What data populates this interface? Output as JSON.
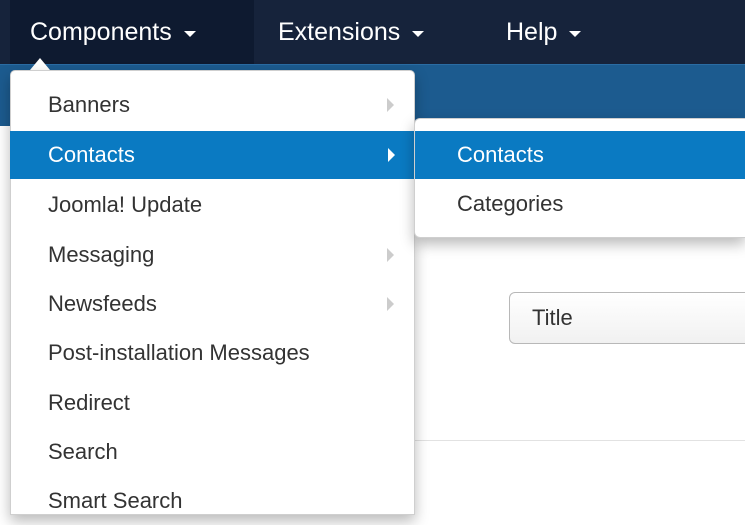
{
  "navbar": {
    "items": [
      {
        "label": "Components",
        "active": true
      },
      {
        "label": "Extensions",
        "active": false
      },
      {
        "label": "Help",
        "active": false
      }
    ]
  },
  "components_menu": {
    "items": [
      {
        "label": "Banners",
        "has_submenu": true,
        "highlighted": false
      },
      {
        "label": "Contacts",
        "has_submenu": true,
        "highlighted": true
      },
      {
        "label": "Joomla! Update",
        "has_submenu": false,
        "highlighted": false
      },
      {
        "label": "Messaging",
        "has_submenu": true,
        "highlighted": false
      },
      {
        "label": "Newsfeeds",
        "has_submenu": true,
        "highlighted": false
      },
      {
        "label": "Post-installation Messages",
        "has_submenu": false,
        "highlighted": false
      },
      {
        "label": "Redirect",
        "has_submenu": false,
        "highlighted": false
      },
      {
        "label": "Search",
        "has_submenu": false,
        "highlighted": false
      },
      {
        "label": "Smart Search",
        "has_submenu": false,
        "highlighted": false
      }
    ]
  },
  "contacts_submenu": {
    "items": [
      {
        "label": "Contacts",
        "highlighted": true
      },
      {
        "label": "Categories",
        "highlighted": false
      }
    ]
  },
  "sort_select": {
    "value": "Title"
  },
  "colors": {
    "navbar": "#16233b",
    "subheader": "#1c5b8f",
    "highlight": "#0a7ac2"
  },
  "icons": {
    "dropdown_caret": "caret-down-icon",
    "submenu_arrow": "chevron-right-icon"
  }
}
